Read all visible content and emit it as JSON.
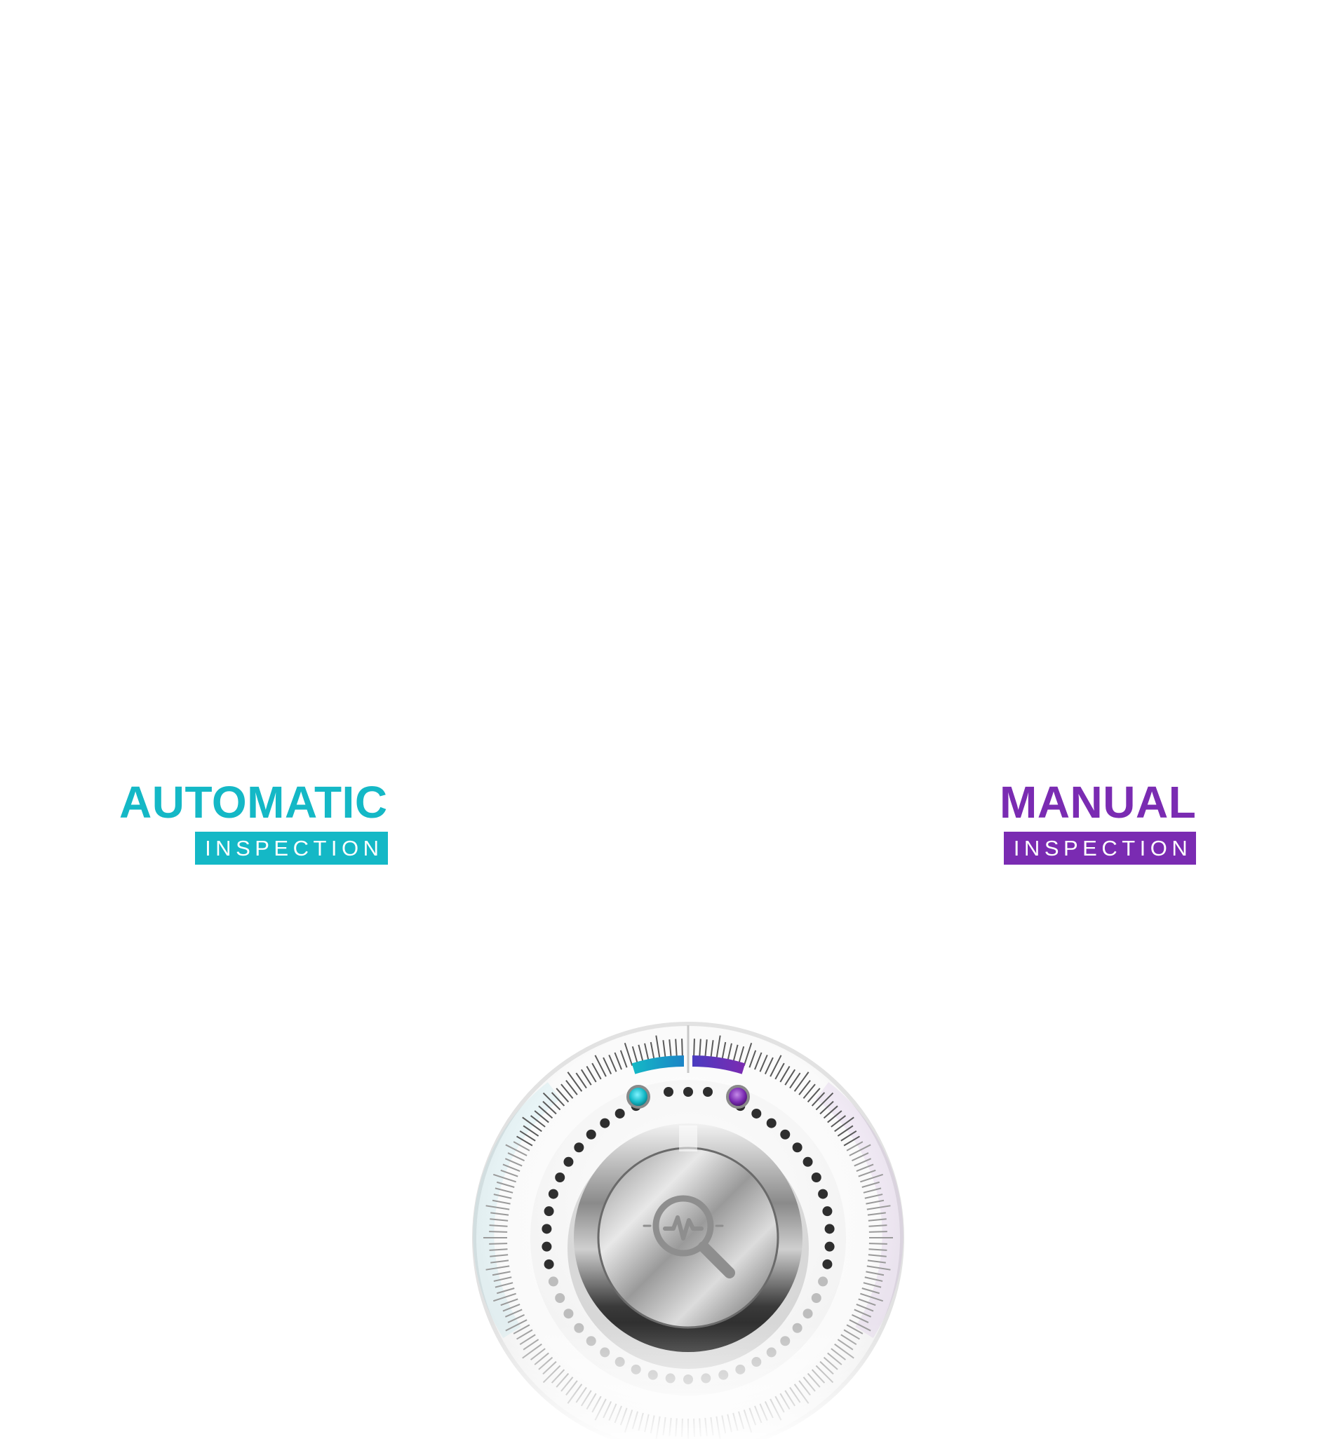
{
  "modes": {
    "automatic": {
      "title": "AUTOMATIC",
      "subtitle": "INSPECTION",
      "color": "#14b8c6"
    },
    "manual": {
      "title": "MANUAL",
      "subtitle": "INSPECTION",
      "color": "#7a2bb2"
    }
  },
  "dial": {
    "center_icon": "waveform-magnifier-icon",
    "colors": {
      "automatic_accent": "#14b8c6",
      "manual_accent": "#7a2bb2",
      "knob_dark": "#2b2b2b",
      "knob_light": "#e6e6e6"
    }
  }
}
